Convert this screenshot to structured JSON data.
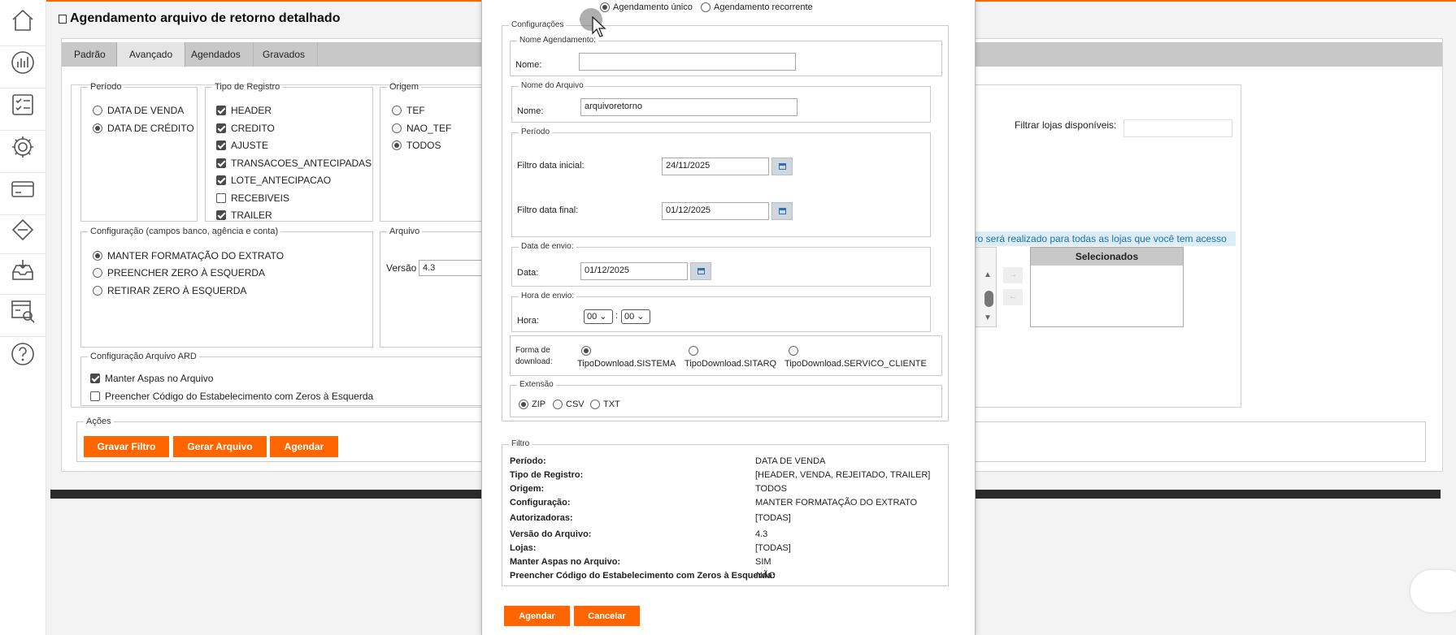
{
  "page_title": "Agendamento arquivo de retorno detalhado",
  "tabs": [
    "Padrão",
    "Avançado",
    "Agendados",
    "Gravados"
  ],
  "periodo": {
    "legend": "Período",
    "options": [
      "DATA DE VENDA",
      "DATA DE CRÉDITO"
    ],
    "selected": 1
  },
  "tipo_registro": {
    "legend": "Tipo de Registro",
    "items": [
      {
        "label": "HEADER",
        "checked": true
      },
      {
        "label": "CREDITO",
        "checked": true
      },
      {
        "label": "AJUSTE",
        "checked": true
      },
      {
        "label": "TRANSACOES_ANTECIPADAS",
        "checked": true
      },
      {
        "label": "LOTE_ANTECIPACAO",
        "checked": true
      },
      {
        "label": "RECEBIVEIS",
        "checked": false
      },
      {
        "label": "TRAILER",
        "checked": true
      }
    ]
  },
  "origem": {
    "legend": "Origem",
    "options": [
      "TEF",
      "NAO_TEF",
      "TODOS"
    ],
    "selected": 2
  },
  "configuracao": {
    "legend": "Configuração (campos banco, agência e conta)",
    "options": [
      "MANTER FORMATAÇÃO DO EXTRATO",
      "PREENCHER ZERO À ESQUERDA",
      "RETIRAR ZERO À ESQUERDA"
    ],
    "selected": 0
  },
  "arquivo": {
    "legend": "Arquivo",
    "versao_label": "Versão",
    "versao_value": "4.3"
  },
  "config_ard": {
    "legend": "Configuração Arquivo ARD",
    "items": [
      {
        "label": "Manter Aspas no Arquivo",
        "checked": true
      },
      {
        "label": "Preencher Código do Estabelecimento com Zeros à Esquerda",
        "checked": false
      }
    ]
  },
  "acoes": {
    "legend": "Ações",
    "buttons": [
      "Gravar Filtro",
      "Gerar Arquivo",
      "Agendar"
    ]
  },
  "lojas": {
    "filter_label": "Filtrar lojas disponíveis:",
    "info": "iltro será realizado para todas as lojas que você tem acesso",
    "selected_header": "Selecionados"
  },
  "modal": {
    "tipo_agendamento": {
      "options": [
        "Agendamento único",
        "Agendamento recorrente"
      ],
      "selected": 0
    },
    "configuracoes_legend": "Configurações",
    "nome_agendamento": {
      "legend": "Nome Agendamento:",
      "label": "Nome:",
      "value": ""
    },
    "nome_arquivo": {
      "legend": "Nome do Arquivo",
      "label": "Nome:",
      "value": "arquivoretorno"
    },
    "periodo": {
      "legend": "Período",
      "inicial_label": "Filtro data inicial:",
      "inicial_value": "24/11/2025",
      "final_label": "Filtro data final:",
      "final_value": "01/12/2025"
    },
    "data_envio": {
      "legend": "Data de envio:",
      "label": "Data:",
      "value": "01/12/2025"
    },
    "hora_envio": {
      "legend": "Hora de envio:",
      "label": "Hora:",
      "hour": "00",
      "sep": ":",
      "minute": "00"
    },
    "forma_download": {
      "label_line1": "Forma de",
      "label_line2": "download:",
      "options": [
        "TipoDownload.SISTEMA",
        "TipoDownload.SITARQ",
        "TipoDownload.SERVICO_CLIENTE"
      ],
      "selected": 0
    },
    "extensao": {
      "legend": "Extensão",
      "options": [
        "ZIP",
        "CSV",
        "TXT"
      ],
      "selected": 0
    },
    "filtro": {
      "legend": "Filtro",
      "rows": [
        {
          "k": "Período:",
          "v": "DATA DE VENDA"
        },
        {
          "k": "Tipo de Registro:",
          "v": "[HEADER, VENDA, REJEITADO, TRAILER]"
        },
        {
          "k": "Origem:",
          "v": "TODOS"
        },
        {
          "k": "Configuração:",
          "v": "MANTER FORMATAÇÃO DO EXTRATO"
        },
        {
          "k": "Autorizadoras:",
          "v": "[TODAS]"
        },
        {
          "k": "Versão do Arquivo:",
          "v": "4.3"
        },
        {
          "k": "Lojas:",
          "v": "[TODAS]"
        },
        {
          "k": "Manter Aspas no Arquivo:",
          "v": "SIM"
        },
        {
          "k": "Preencher Código do Estabelecimento com Zeros à Esquerda:",
          "v": "NÃO"
        }
      ]
    },
    "buttons": {
      "agendar": "Agendar",
      "cancelar": "Cancelar"
    }
  },
  "sidebar_icons": [
    "home-icon",
    "dashboard-icon",
    "checklist-icon",
    "settings-icon",
    "card-icon",
    "diamond-icon",
    "inbox-icon",
    "report-search-icon",
    "help-icon"
  ],
  "colors": {
    "accent": "#ff6600",
    "tab_bar": "#c8c8c8",
    "info_text": "#1e6fa8"
  }
}
